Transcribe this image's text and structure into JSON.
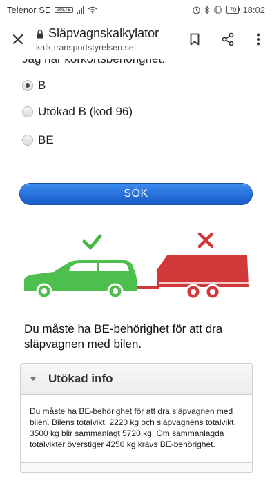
{
  "status_bar": {
    "carrier": "Telenor SE",
    "volte": "VoLTE",
    "battery": "79",
    "time": "18:02"
  },
  "toolbar": {
    "title": "Släpvagnskalkylator",
    "url": "kalk.transportstyrelsen.se",
    "icons": [
      "close-icon",
      "lock-icon",
      "bookmark-icon",
      "share-icon",
      "more-vert-icon"
    ]
  },
  "form": {
    "question_label": "Jag har körkortsbehörighet:",
    "options": [
      {
        "label": "B",
        "selected": true
      },
      {
        "label": "Utökad B (kod 96)",
        "selected": false
      },
      {
        "label": "BE",
        "selected": false
      }
    ],
    "search_button": "SÖK"
  },
  "illustration": {
    "car_status": "ok",
    "trailer_status": "not-ok",
    "colors": {
      "ok": "#4cbf4c",
      "not_ok": "#d0383a"
    }
  },
  "result": {
    "message": "Du måste ha BE-behörighet för att dra släpvagnen med bilen."
  },
  "accordion": {
    "title": "Utökad info",
    "body": "Du måste ha BE-behörighet för att dra släpvagnen med bilen. Bilens totalvikt, 2220 kg och släpvagnens totalvikt, 3500 kg blir sammanlagt 5720 kg. Om sammanlagda totalvikter överstiger 4250 kg krävs BE-behörighet."
  }
}
